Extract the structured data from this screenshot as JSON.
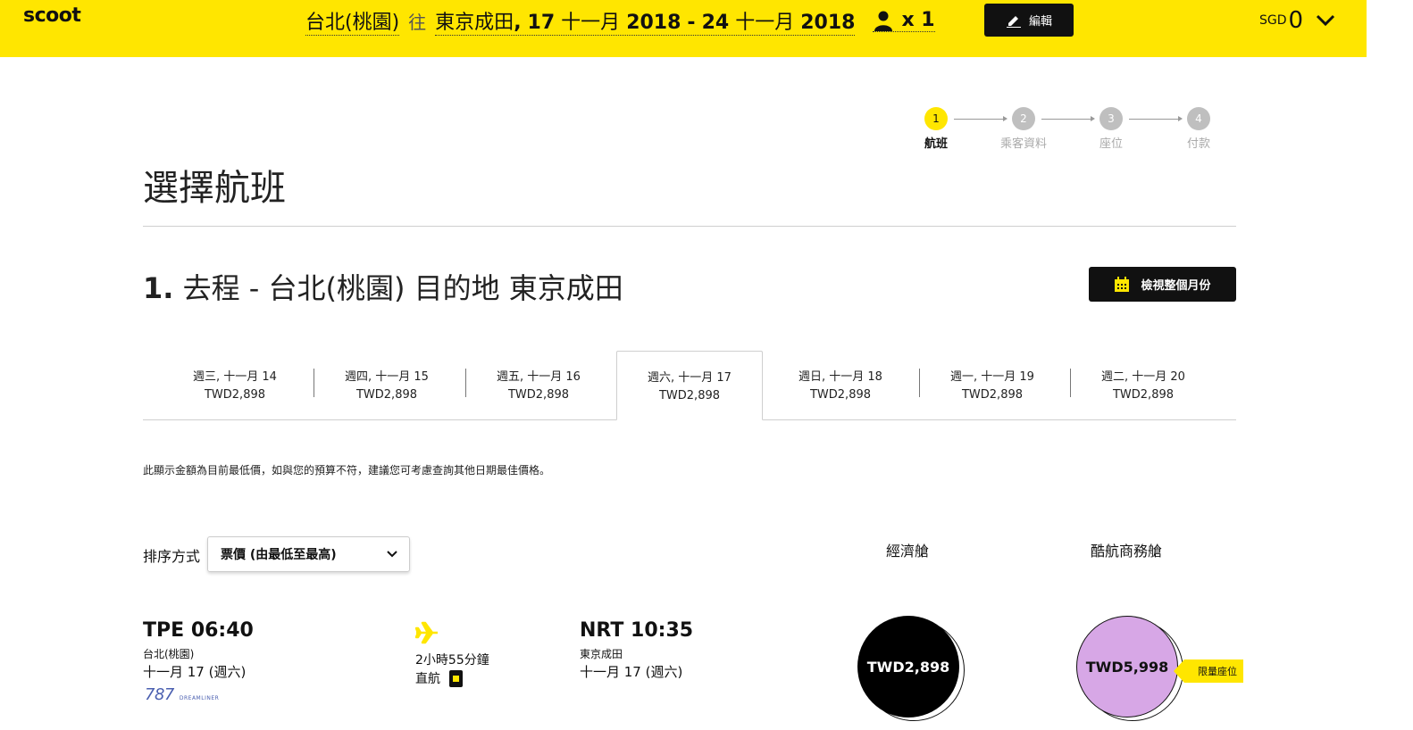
{
  "header": {
    "logo": "scoot",
    "origin": "台北(桃園)",
    "connector": "往",
    "destination": "東京成田",
    "comma": ",",
    "depart_day": "17",
    "depart_month": "十一月",
    "depart_year": "2018",
    "range_sep": "-",
    "return_day": "24",
    "return_month": "十一月",
    "return_year": "2018",
    "passengers": "x 1",
    "edit_label": "編輯",
    "currency_code": "SGD",
    "currency_amount": "0"
  },
  "steps": [
    {
      "num": "1",
      "label": "航班"
    },
    {
      "num": "2",
      "label": "乘客資料"
    },
    {
      "num": "3",
      "label": "座位"
    },
    {
      "num": "4",
      "label": "付款"
    }
  ],
  "page_title": "選擇航班",
  "section": {
    "number": "1.",
    "title": "去程 - 台北(桃園) 目的地 東京成田",
    "month_button": "檢視整個月份"
  },
  "date_tabs": [
    {
      "date": "週三, 十一月 14",
      "price": "TWD2,898"
    },
    {
      "date": "週四, 十一月 15",
      "price": "TWD2,898"
    },
    {
      "date": "週五, 十一月 16",
      "price": "TWD2,898"
    },
    {
      "date": "週六, 十一月 17",
      "price": "TWD2,898"
    },
    {
      "date": "週日, 十一月 18",
      "price": "TWD2,898"
    },
    {
      "date": "週一, 十一月 19",
      "price": "TWD2,898"
    },
    {
      "date": "週二, 十一月 20",
      "price": "TWD2,898"
    }
  ],
  "notice": "此顯示金額為目前最低價，如與您的預算不符，建議您可考慮查詢其他日期最佳價格。",
  "sort": {
    "label": "排序方式",
    "selected": "票價 (由最低至最高)"
  },
  "fare_columns": {
    "economy": "經濟艙",
    "business": "酷航商務艙"
  },
  "flight": {
    "dep_code_time": "TPE 06:40",
    "dep_city": "台北(桃園)",
    "dep_date": "十一月 17 (週六)",
    "aircraft_num": "787",
    "aircraft_name": "DREAMLINER",
    "duration": "2小時55分鐘",
    "stops": "直航",
    "arr_code_time": "NRT 10:35",
    "arr_city": "東京成田",
    "arr_date": "十一月 17 (週六)",
    "economy_price": "TWD2,898",
    "business_price": "TWD5,998",
    "limited_label": "限量座位"
  },
  "colors": {
    "brand_yellow": "#ffe600",
    "black": "#111111",
    "business_purple": "#d7a7e6"
  }
}
